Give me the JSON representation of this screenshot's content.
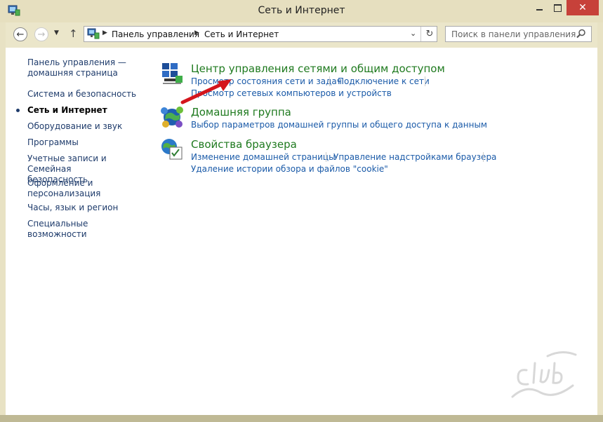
{
  "window": {
    "title": "Сеть и Интернет"
  },
  "nav": {
    "breadcrumbs": [
      "Панель управления",
      "Сеть и Интернет"
    ],
    "search_placeholder": "Поиск в панели управления"
  },
  "sidebar": {
    "home_line1": "Панель управления —",
    "home_line2": "домашняя страница",
    "items": [
      "Система и безопасность",
      "Сеть и Интернет",
      "Оборудование и звук",
      "Программы",
      "Учетные записи и Семейная безопасность",
      "Оформление и персонализация",
      "Часы, язык и регион",
      "Специальные возможности"
    ],
    "accounts_line1": "Учетные записи и Семейная",
    "accounts_line2": "безопасность",
    "appearance_line1": "Оформление и",
    "appearance_line2": "персонализация"
  },
  "categories": [
    {
      "title": "Центр управления сетями и общим доступом",
      "icon": "network-center-icon",
      "tasks": [
        "Просмотр состояния сети и задач",
        "Подключение к сети",
        "Просмотр сетевых компьютеров и устройств"
      ]
    },
    {
      "title": "Домашняя группа",
      "icon": "homegroup-icon",
      "tasks": [
        "Выбор параметров домашней группы и общего доступа к данным"
      ]
    },
    {
      "title": "Свойства браузера",
      "icon": "internet-options-icon",
      "tasks": [
        "Изменение домашней страницы",
        "Управление надстройками браузера",
        "Удаление истории обзора и файлов \"cookie\""
      ]
    }
  ],
  "colors": {
    "category_title": "#1f7a1f",
    "task_link": "#1a5aa8",
    "close_button": "#c7413a",
    "arrow": "#d4151c"
  }
}
